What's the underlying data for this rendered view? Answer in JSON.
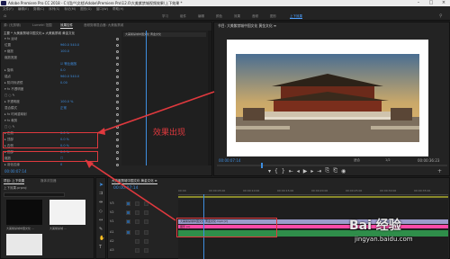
{
  "window": {
    "title": "Adobe Premiere Pro CC 2018 - C:\\用户\\文档\\Adobe\\Premiere Pro\\12.0\\大美紫禁城视频效果\\上下效果 *"
  },
  "menu": [
    "文件(F)",
    "编辑(E)",
    "剪辑(C)",
    "序列(S)",
    "标记(M)",
    "图形(G)",
    "窗口(W)",
    "帮助(H)"
  ],
  "workspaces": [
    {
      "label": "学习",
      "active": false
    },
    {
      "label": "组件",
      "active": false
    },
    {
      "label": "编辑",
      "active": false
    },
    {
      "label": "颜色",
      "active": false
    },
    {
      "label": "效果",
      "active": false
    },
    {
      "label": "音频",
      "active": false
    },
    {
      "label": "图形",
      "active": false
    },
    {
      "label": "上下效果",
      "active": true
    }
  ],
  "source_panel": {
    "tabs": [
      {
        "label": "源: (无剪辑)",
        "active": false
      },
      {
        "label": "Lumetri 范围",
        "active": false
      },
      {
        "label": "效果控件",
        "active": true
      },
      {
        "label": "音频剪辑混合器: 大美紫禁城",
        "active": false
      }
    ],
    "header": "主要 * 大美紫禁城中国文化 ▸ 大美紫禁城 黄金文化",
    "rows": [
      {
        "label": "▾ fx 运动",
        "value": ""
      },
      {
        "label": "  位置",
        "value": "960.0  540.0"
      },
      {
        "label": "▾ 缩放",
        "value": "100.0"
      },
      {
        "label": "  缩放宽度",
        "value": ""
      },
      {
        "label": "",
        "value": "☑ 等比缩放"
      },
      {
        "label": "▸ 旋转",
        "value": "0.0"
      },
      {
        "label": "  锚点",
        "value": "960.0  540.0"
      },
      {
        "label": "▸ 防闪烁滤镜",
        "value": "0.00"
      },
      {
        "label": "▾ fx 不透明度",
        "value": ""
      },
      {
        "label": "  □ ○ ✎",
        "value": ""
      },
      {
        "label": "▸ 不透明度",
        "value": "100.0 %"
      },
      {
        "label": "  混合模式",
        "value": "正常"
      },
      {
        "label": "▸ fx 时间重映射",
        "value": ""
      },
      {
        "label": "▾ fx 裁剪",
        "value": ""
      },
      {
        "label": "  □ ○ ✎",
        "value": ""
      },
      {
        "label": "  ▸ 左侧",
        "value": "0.0 %"
      },
      {
        "label": "  ▸ 顶部",
        "value": "0.0 %"
      },
      {
        "label": "  ▸ 右侧",
        "value": "0.0 %"
      },
      {
        "label": "  ▸ 底部",
        "value": "0.0 %"
      },
      {
        "label": "  缩放",
        "value": "☐"
      },
      {
        "label": "▸ 羽化边缘",
        "value": "0"
      }
    ],
    "timecode": "00:00:07:14",
    "mini_clip": "大美紫禁城中国文化 黄金文化"
  },
  "annotation": {
    "text": "效果出现",
    "color": "#e0393e"
  },
  "program": {
    "title": "节目: 大美紫禁城中国文化 黄金文化 ≡",
    "timecode": "00:00:07:14",
    "fit": "适合",
    "ratio": "1/2",
    "duration": "00:00:36:23"
  },
  "project": {
    "tabs": [
      {
        "label": "项目: 上下效果",
        "active": true
      },
      {
        "label": "媒体浏览器",
        "active": false
      }
    ],
    "name": "上下效果.prproj",
    "items": [
      {
        "label": "大美紫禁城中国文化 ..."
      },
      {
        "label": "大美紫禁城 ..."
      }
    ]
  },
  "timeline": {
    "tab": "大美紫禁城中国文化 黄金文化 ≡",
    "timecode": "00:00:07:14",
    "ruler": [
      "00:00",
      "00:00:05:00",
      "00:00:10:00",
      "00:00:15:00",
      "00:00:20:00",
      "00:00:25:00",
      "00:00:30:00",
      "00:00:35:00"
    ],
    "video_tracks": [
      {
        "name": "V3"
      },
      {
        "name": "V2"
      },
      {
        "name": "V1"
      }
    ],
    "audio_tracks": [
      {
        "name": "A1"
      },
      {
        "name": "A2"
      },
      {
        "name": "A3"
      }
    ],
    "clips": [
      {
        "label": "大美紫禁城中国文化 黄金文化.mp4 [V]",
        "color": "#9c9ccc"
      },
      {
        "label": "图形 [A]",
        "color": "#ff4aa8"
      }
    ]
  },
  "watermark": {
    "brand": "Bai 经验",
    "url": "jingyan.baidu.com"
  }
}
